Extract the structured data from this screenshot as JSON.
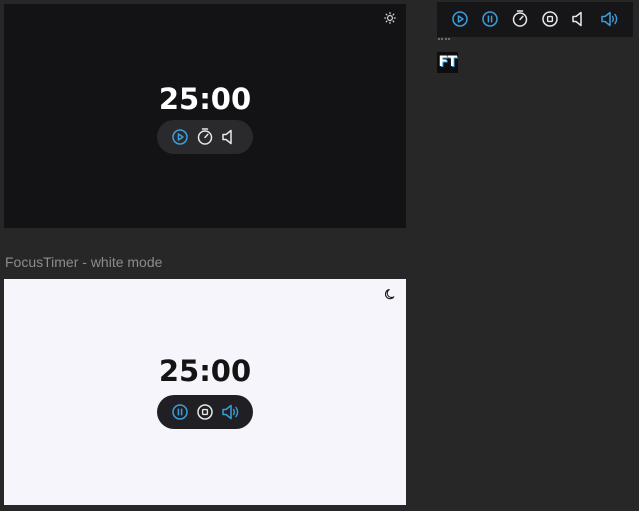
{
  "dark_preview": {
    "time": "25:00",
    "mode_icon": "sun-icon",
    "controls": [
      "play-icon",
      "stopwatch-icon",
      "volume-muted-icon"
    ]
  },
  "caption": "FocusTimer - white mode",
  "white_preview": {
    "time": "25:00",
    "mode_icon": "moon-icon",
    "controls": [
      "pause-icon",
      "stop-icon",
      "volume-on-icon"
    ]
  },
  "icon_sheet": {
    "icons": [
      "play-icon",
      "pause-icon",
      "stopwatch-icon",
      "stop-icon",
      "volume-muted-icon",
      "volume-on-icon"
    ]
  },
  "app_badge": {
    "text": "FT"
  },
  "colors": {
    "accent": "#3b9ed9",
    "dark_bg": "#131315",
    "light_bg": "#f5f5fb",
    "page_bg": "#272727"
  }
}
